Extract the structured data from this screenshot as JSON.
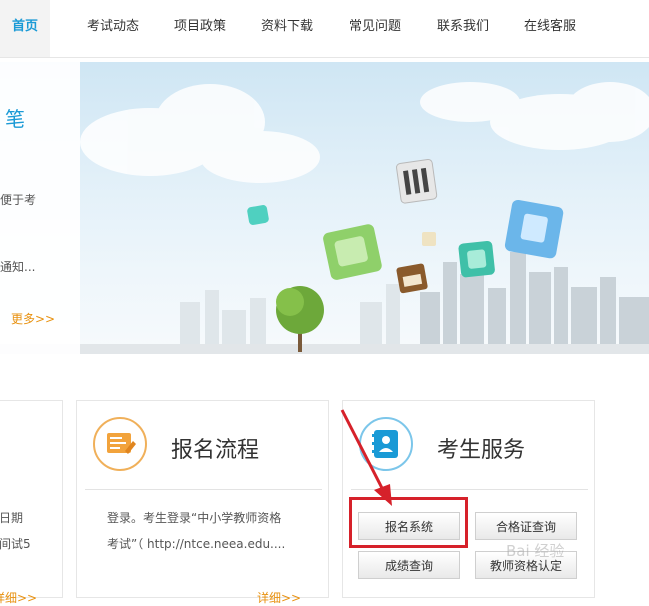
{
  "nav": {
    "items": [
      {
        "label": "首页",
        "active": true
      },
      {
        "label": "考试动态"
      },
      {
        "label": "项目政策"
      },
      {
        "label": "资料下载"
      },
      {
        "label": "常见问题"
      },
      {
        "label": "联系我们"
      },
      {
        "label": "在线客服"
      }
    ]
  },
  "banner": {
    "panel_title": "笔",
    "panel_line1": "便于考",
    "panel_line2": "通知...",
    "more": "更多>>"
  },
  "cards": {
    "left": {
      "line1": "日期",
      "line2": "间试5",
      "more": "详细>>"
    },
    "middle": {
      "title": "报名流程",
      "line1": "登录。考生登录“中小学教师资格",
      "line2": "考试”（ http://ntce.neea.edu....",
      "more": "详细>>"
    },
    "right": {
      "title": "考生服务",
      "buttons": [
        "报名系统",
        "合格证查询",
        "成绩查询",
        "教师资格认定"
      ]
    }
  },
  "watermark": "Bai 经验",
  "colors": {
    "accent": "#1a9ad6",
    "more": "#e8910f",
    "highlight": "#d6212a"
  }
}
